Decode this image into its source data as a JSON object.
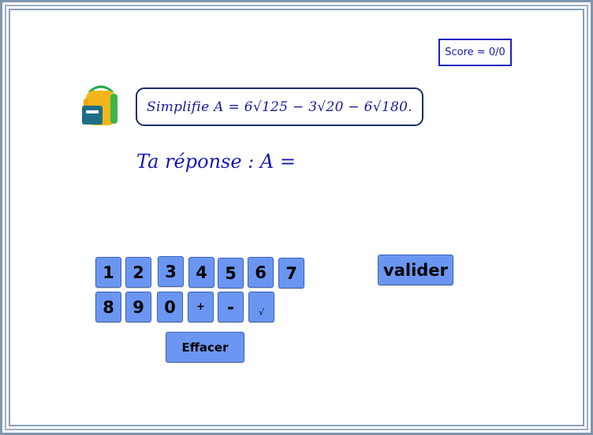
{
  "score": "Score = 0/0",
  "question": "Simplifie A = 6√125 − 3√20 − 6√180.",
  "answer_prompt": "Ta réponse : A =",
  "keypad": {
    "row1": [
      "1",
      "2",
      "3",
      "4",
      "5",
      "6",
      "7"
    ],
    "row2": [
      "8",
      "9",
      "0",
      "+",
      "-",
      "√"
    ],
    "clear_label": "Effacer"
  },
  "validate_label": "valider",
  "icons": {
    "bag": "backpack-icon"
  },
  "colors": {
    "key": "#6a96f2",
    "text_blue": "#1616b8",
    "score_border": "#1f1fc4"
  }
}
